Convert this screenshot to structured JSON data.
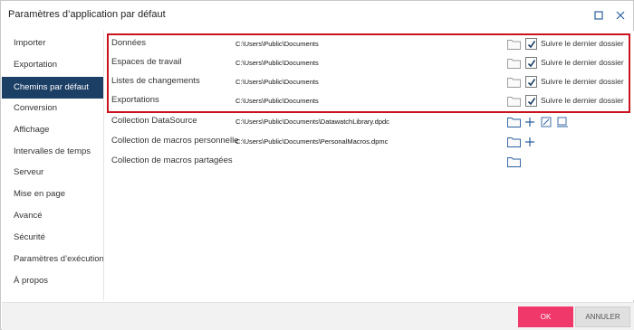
{
  "window": {
    "title": "Paramètres d’application par défaut",
    "maximize_icon": "maximize-icon",
    "close_icon": "close-icon"
  },
  "sidebar": {
    "items": [
      {
        "label": "Importer",
        "active": false
      },
      {
        "label": "Exportation",
        "active": false
      },
      {
        "label": "Chemins par défaut",
        "active": true
      },
      {
        "label": "Conversion",
        "active": false
      },
      {
        "label": "Affichage",
        "active": false
      },
      {
        "label": "Intervalles de temps",
        "active": false
      },
      {
        "label": "Serveur",
        "active": false
      },
      {
        "label": "Mise en page",
        "active": false
      },
      {
        "label": "Avancé",
        "active": false
      },
      {
        "label": "Sécurité",
        "active": false
      },
      {
        "label": "Paramètres d’exécution",
        "active": false
      },
      {
        "label": "À propos",
        "active": false
      }
    ]
  },
  "paths": {
    "rows": [
      {
        "label": "Données",
        "path": "C:\\Users\\Public\\Documents",
        "follow_label": "Suivre le dernier dossier",
        "follow_checked": true
      },
      {
        "label": "Espaces de travail",
        "path": "C:\\Users\\Public\\Documents",
        "follow_label": "Suivre le dernier dossier",
        "follow_checked": true
      },
      {
        "label": "Listes de changements",
        "path": "C:\\Users\\Public\\Documents",
        "follow_label": "Suivre le dernier dossier",
        "follow_checked": true
      },
      {
        "label": "Exportations",
        "path": "C:\\Users\\Public\\Documents",
        "follow_label": "Suivre le dernier dossier",
        "follow_checked": true
      },
      {
        "label": "Collection DataSource",
        "path": "C:\\Users\\Public\\Documents\\DatawatchLibrary.dpdc"
      },
      {
        "label": "Collection de macros personnelle",
        "path": "C:\\Users\\Public\\Documents\\PersonalMacros.dpmc"
      },
      {
        "label": "Collection de macros partagées",
        "path": ""
      }
    ]
  },
  "footer": {
    "ok_label": "OK",
    "cancel_label": "ANNULER"
  },
  "colors": {
    "active_nav": "#1c3f66",
    "ok_button": "#f0386b",
    "highlight_border": "#c9141e"
  }
}
